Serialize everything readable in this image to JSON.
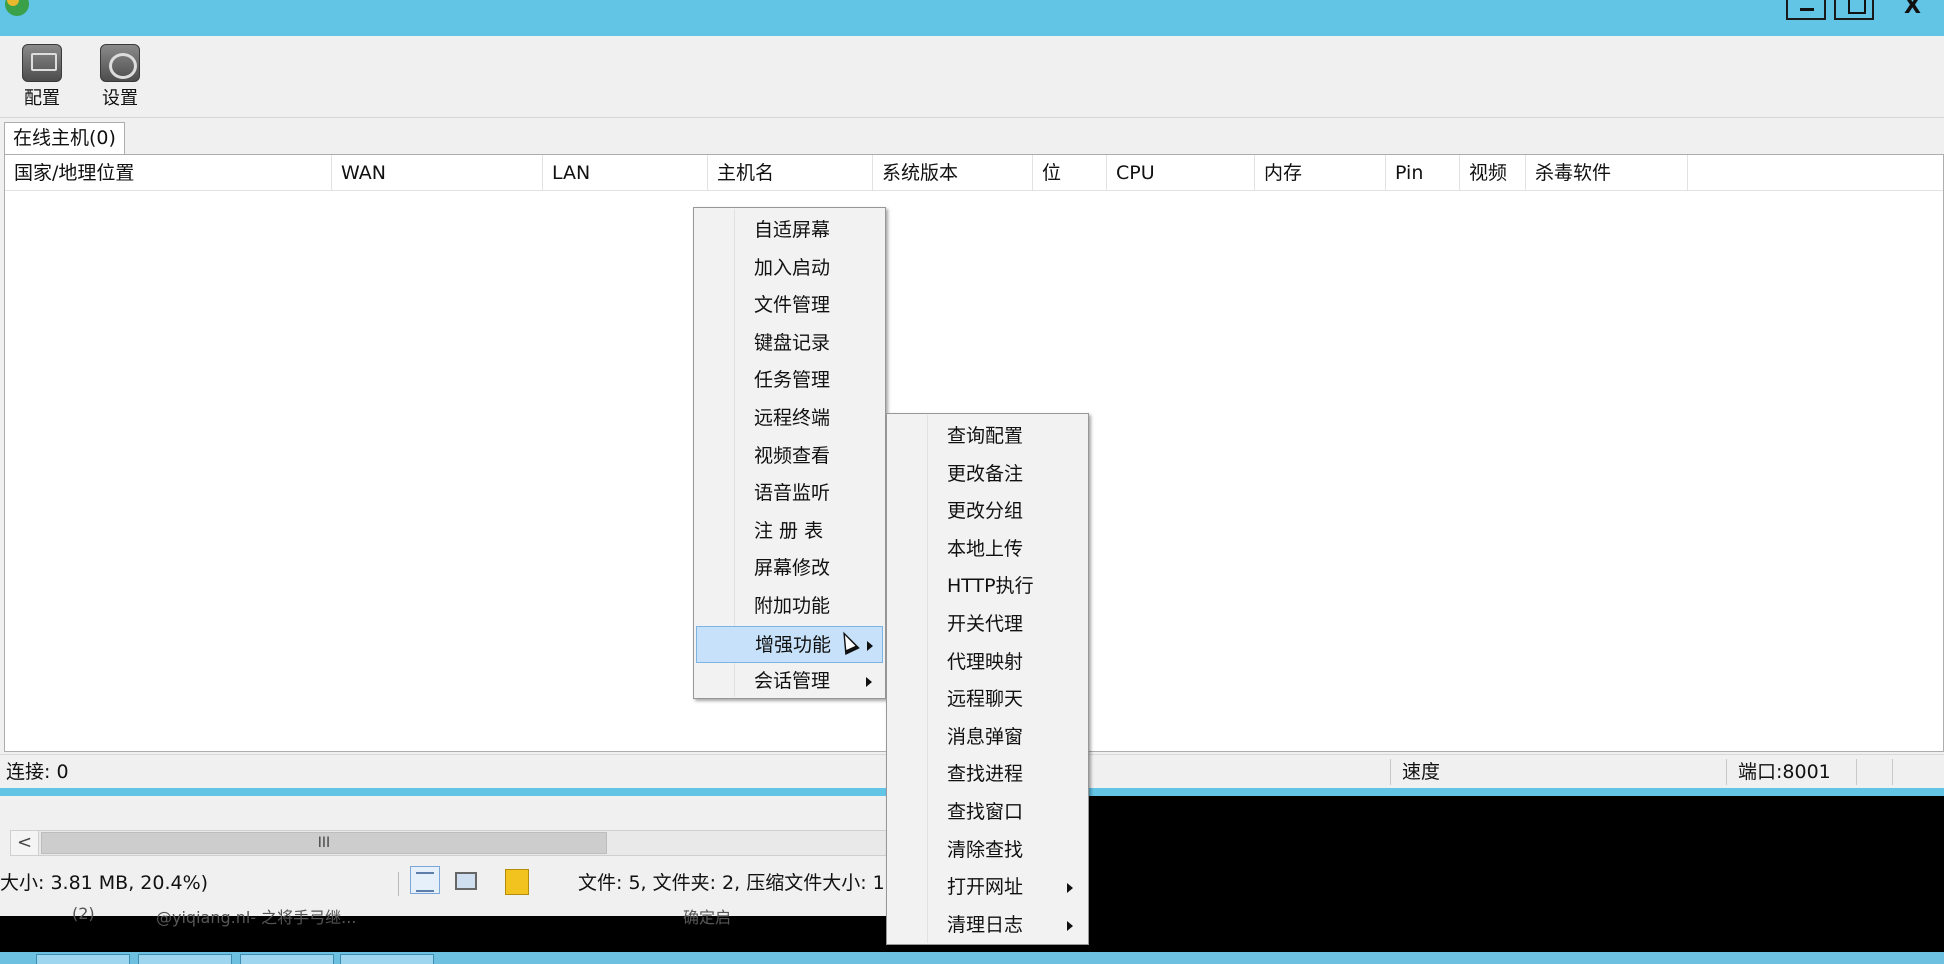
{
  "titlebar": {
    "close_label": "X"
  },
  "toolbar": {
    "config_label": "配置",
    "settings_label": "设置"
  },
  "tab": {
    "label": "在线主机(0)"
  },
  "columns": [
    "国家/地理位置",
    "WAN",
    "LAN",
    "主机名",
    "系统版本",
    "位",
    "CPU",
    "内存",
    "Pin",
    "视频",
    "杀毒软件"
  ],
  "statusbar": {
    "connections": "连接: 0",
    "speed": "速度",
    "port": "端口:8001"
  },
  "context_menu": {
    "items": [
      "自适屏幕",
      "加入启动",
      "文件管理",
      "键盘记录",
      "任务管理",
      "远程终端",
      "视频查看",
      "语音监听",
      "注 册 表",
      "屏幕修改",
      "附加功能",
      "增强功能",
      "会话管理"
    ],
    "highlighted": "增强功能",
    "submenu_parents": [
      "增强功能",
      "会话管理"
    ]
  },
  "submenu": {
    "items": [
      "查询配置",
      "更改备注",
      "更改分组",
      "本地上传",
      "HTTP执行",
      "开关代理",
      "代理映射",
      "远程聊天",
      "消息弹窗",
      "查找进程",
      "查找窗口",
      "清除查找",
      "打开网址",
      "清理日志"
    ],
    "submenu_parents": [
      "打开网址",
      "清理日志"
    ]
  },
  "background_window": {
    "scroll_thumb_label": "III",
    "scroll_left_label": "<",
    "status_left": "大小: 3.81 MB, 20.4%)",
    "status_right": "文件: 5, 文件夹: 2, 压缩文件大小: 1",
    "behind_text_1": "(2)",
    "behind_text_2": "@yiqiang.nl- 之将手弓继...",
    "behind_text_3": "确定启"
  },
  "colors": {
    "titlebar": "#63c5e6",
    "menu_highlight": "#c6e1f9",
    "window_bg": "#f0f0f0"
  }
}
